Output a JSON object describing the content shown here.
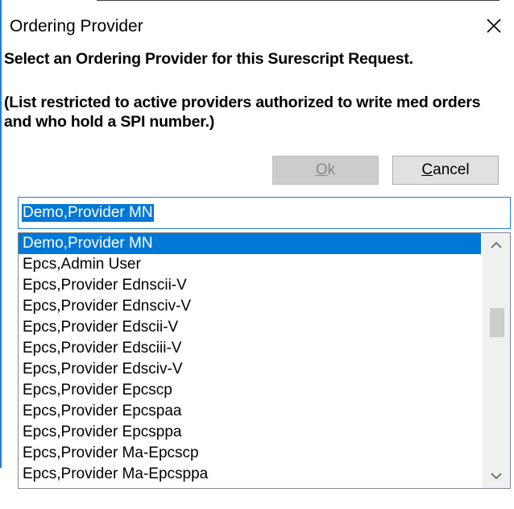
{
  "dialog": {
    "title": "Ordering Provider",
    "close_icon": "close-icon"
  },
  "prompt": {
    "main": "Select an Ordering Provider for this Surescript Request.",
    "note": "(List restricted to active providers authorized to write med orders and who hold a SPI number.)"
  },
  "buttons": {
    "ok_mnemonic": "O",
    "ok_rest": "k",
    "cancel_mnemonic": "C",
    "cancel_rest": "ancel"
  },
  "search": {
    "value": "Demo,Provider MN"
  },
  "provider_list": {
    "selected_index": 0,
    "items": [
      "Demo,Provider MN",
      "Epcs,Admin User",
      "Epcs,Provider Ednscii-V",
      "Epcs,Provider Ednsciv-V",
      "Epcs,Provider Edscii-V",
      "Epcs,Provider Edsciii-V",
      "Epcs,Provider Edsciv-V",
      "Epcs,Provider Epcscp",
      "Epcs,Provider Epcspaa",
      "Epcs,Provider Epcsppa",
      "Epcs,Provider Ma-Epcscp",
      "Epcs,Provider Ma-Epcsppa"
    ]
  },
  "scrollbar": {
    "up_icon": "chevron-up-icon",
    "down_icon": "chevron-down-icon"
  },
  "colors": {
    "selection": "#0078d7",
    "focus_border": "#1f7bd6",
    "disabled_button": "#cccccc"
  }
}
